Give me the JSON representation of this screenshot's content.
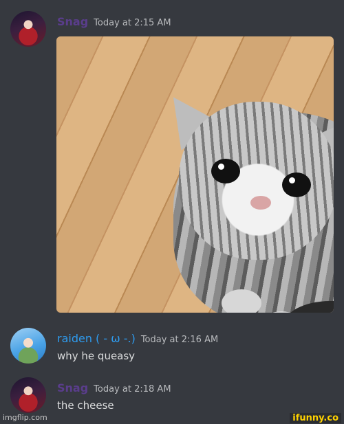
{
  "messages": [
    {
      "username": "Snag",
      "timestamp": "Today at 2:15 AM",
      "content": "",
      "avatar": "anime-dark-hair-avatar"
    },
    {
      "username": "raiden ( - ω -.)",
      "timestamp": "Today at 2:16 AM",
      "content": "why he queasy",
      "avatar": "anime-blue-hair-avatar"
    },
    {
      "username": "Snag",
      "timestamp": "Today at 2:18 AM",
      "content": "the cheese",
      "avatar": "anime-dark-hair-avatar"
    }
  ],
  "image": {
    "subject": "sad-cat-photo"
  },
  "watermarks": {
    "left": "imgflip.com",
    "right": "ifunny.co"
  },
  "colors": {
    "background": "#36393f",
    "username_purple": "#5a3d8c",
    "username_blue": "#2e9cf0",
    "timestamp": "#b9bbbe",
    "text": "#dcddde"
  }
}
